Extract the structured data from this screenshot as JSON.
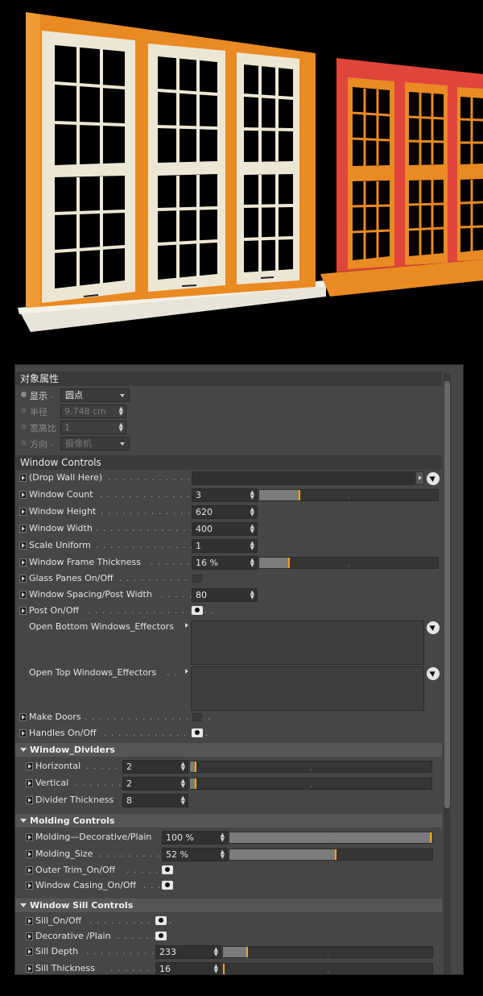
{
  "object_properties": {
    "title": "对象属性",
    "display": {
      "label": "显示",
      "value": "圆点"
    },
    "radius": {
      "label": "半径",
      "value": "9.748 cm"
    },
    "aspect": {
      "label": "宽高比",
      "value": "1"
    },
    "direction": {
      "label": "方向",
      "value": "摄像机"
    }
  },
  "window_controls": {
    "title": "Window Controls",
    "drop_wall": {
      "label": "(Drop Wall Here)"
    },
    "window_count": {
      "label": "Window Count",
      "value": "3",
      "slider_fraction": 0.22
    },
    "window_height": {
      "label": "Window Height",
      "value": "620"
    },
    "window_width": {
      "label": "Window Width",
      "value": "400"
    },
    "scale_uniform": {
      "label": "Scale Uniform",
      "value": "1"
    },
    "frame_thickness": {
      "label": "Window Frame Thickness",
      "value": "16 %",
      "slider_fraction": 0.16
    },
    "glass_panes": {
      "label": "Glass Panes On/Off"
    },
    "spacing": {
      "label": "Window Spacing/Post Width",
      "value": "80"
    },
    "post": {
      "label": "Post On/Off"
    },
    "open_bottom": {
      "label": "Open Bottom Windows_Effectors"
    },
    "open_top": {
      "label": "Open Top Windows_Effectors"
    },
    "make_doors": {
      "label": "Make Doors"
    },
    "handles": {
      "label": "Handles On/Off"
    }
  },
  "dividers": {
    "title": "Window_Dividers",
    "horizontal": {
      "label": "Horizontal",
      "value": "2",
      "slider_fraction": 0.02
    },
    "vertical": {
      "label": "Vertical",
      "value": "2",
      "slider_fraction": 0.02
    },
    "thickness": {
      "label": "Divider Thickness",
      "value": "8"
    }
  },
  "molding": {
    "title": "Molding Controls",
    "decorative_plain": {
      "label": "Molding—Decorative/Plain",
      "value": "100 %",
      "slider_fraction": 1.0
    },
    "size": {
      "label": "Molding_Size",
      "value": "52 %",
      "slider_fraction": 0.52
    },
    "outer_trim": {
      "label": "Outer Trim_On/Off"
    },
    "casing": {
      "label": "Window Casing_On/Off"
    }
  },
  "sill": {
    "title": "Window Sill Controls",
    "sill_on": {
      "label": "Sill_On/Off"
    },
    "decorative_plain": {
      "label": "Decorative /Plain"
    },
    "depth": {
      "label": "Sill Depth",
      "value": "233",
      "slider_fraction": 0.11
    },
    "thickness": {
      "label": "Sill Thickness",
      "value": "16",
      "slider_fraction": 0.0
    }
  },
  "colors": {
    "orange_frame": "#e98a22",
    "red_frame": "#e0453c",
    "cream_sash": "#ece7d5",
    "slider_mark": "#f0a41a"
  }
}
